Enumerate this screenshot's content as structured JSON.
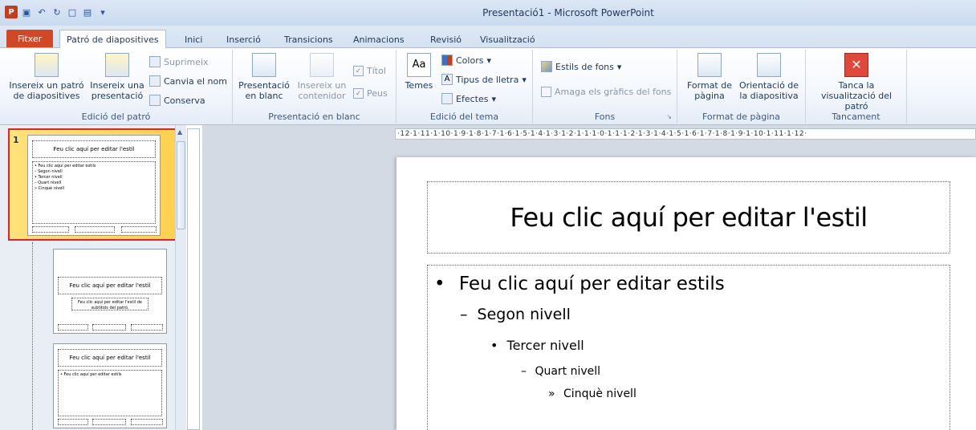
{
  "window": {
    "title": "Presentació1 - Microsoft PowerPoint"
  },
  "qat": {
    "logo": "P"
  },
  "tabs": [
    {
      "label": "Fitxer"
    },
    {
      "label": "Patró de diapositives"
    },
    {
      "label": "Inici"
    },
    {
      "label": "Inserció"
    },
    {
      "label": "Transicions"
    },
    {
      "label": "Animacions"
    },
    {
      "label": "Revisió"
    },
    {
      "label": "Visualització"
    }
  ],
  "ribbon": {
    "edit_master": {
      "label": "Edició del patró",
      "insert_master": "Insereix un patró de diapositives",
      "insert_layout": "Insereix una presentació",
      "delete": "Suprimeix",
      "rename": "Canvia el nom",
      "preserve": "Conserva"
    },
    "master_layout": {
      "label": "Presentació en blanc",
      "blank_layout": "Presentació en blanc",
      "insert_placeholder": "Insereix un contenidor",
      "title_chk": "Títol",
      "footers_chk": "Peus"
    },
    "edit_theme": {
      "label": "Edició del tema",
      "themes": "Temes",
      "colors": "Colors",
      "fonts": "Tipus de lletra",
      "effects": "Efectes"
    },
    "background": {
      "label": "Fons",
      "bg_styles": "Estils de fons",
      "hide_graphics": "Amaga els gràfics del fons"
    },
    "page_setup": {
      "label": "Format de pàgina",
      "page_setup_btn": "Format de pàgina",
      "orientation": "Orientació de la diapositiva"
    },
    "close": {
      "label": "Tancament",
      "close_master": "Tanca la visualització del patró"
    }
  },
  "thumbnails": {
    "selected_num": "1",
    "t1_title": "Feu clic aquí per editar l'estil",
    "t1_body": "• Feu clic aquí per editar estils\n– Segon nivell\n• Tercer nivell\n– Quart nivell\n» Cinquè nivell",
    "t2_title": "Feu clic aquí per editar l'estil",
    "t2_sub": "Feu clic aquí per editar l'estil de subtítols del patró.",
    "t3_title": "Feu clic aquí per editar l'estil",
    "t3_body": "• Feu clic aquí per editar estils"
  },
  "ruler": {
    "horizontal": "·12·1·11·1·10·1·9·1·8·1·7·1·6·1·5·1·4·1·3·1·2·1·1·1·0·1·1·1·2·1·3·1·4·1·5·1·6·1·7·1·8·1·9·1·10·1·11·1·12·"
  },
  "slide": {
    "title": "Feu clic aquí per editar l'estil",
    "level1": "Feu clic aquí per editar estils",
    "level2": "Segon nivell",
    "level3": "Tercer nivell",
    "level4": "Quart nivell",
    "level5": "Cinquè nivell",
    "bullet1": "•",
    "bullet2": "–",
    "bullet3": "•",
    "bullet4": "–",
    "bullet5": "»"
  }
}
